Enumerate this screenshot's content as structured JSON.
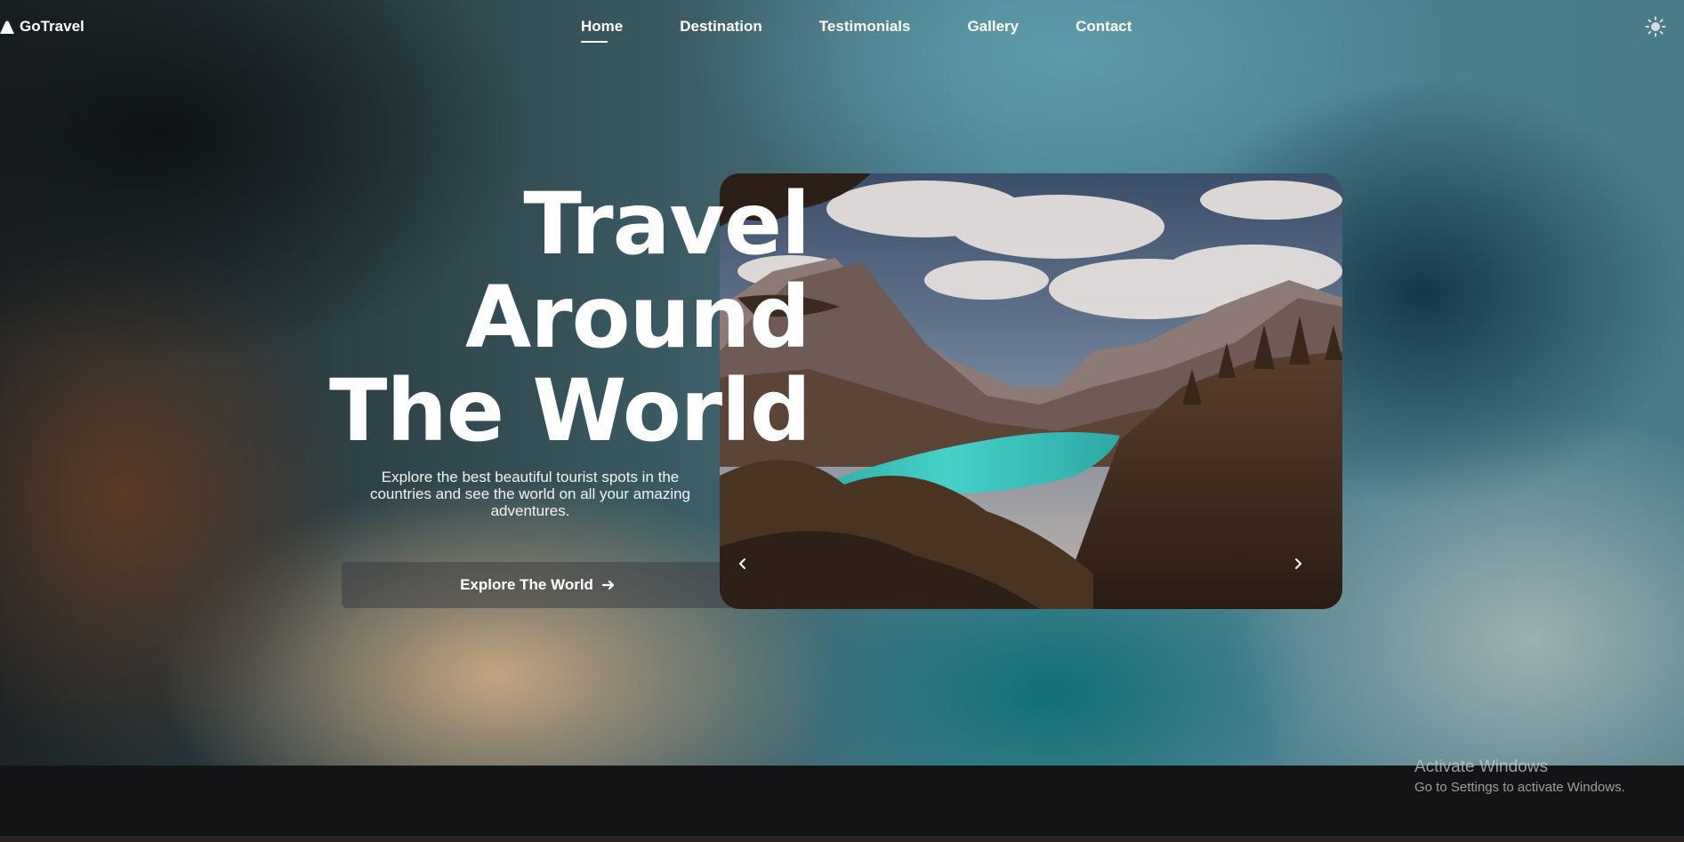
{
  "brand": {
    "name": "GoTravel",
    "logo_icon": "mountain-icon"
  },
  "nav": {
    "links": [
      {
        "label": "Home",
        "active": true
      },
      {
        "label": "Destination",
        "active": false
      },
      {
        "label": "Testimonials",
        "active": false
      },
      {
        "label": "Gallery",
        "active": false
      },
      {
        "label": "Contact",
        "active": false
      }
    ],
    "theme_icon": "sun-icon"
  },
  "hero": {
    "title_lines": [
      "Travel",
      "Around",
      "The World"
    ],
    "description": "Explore the best beautiful tourist spots in the countries and see the world on all your amazing adventures.",
    "cta_label": "Explore The World",
    "cta_icon": "arrow-right-icon"
  },
  "slider": {
    "image_subject": "mountain lake landscape",
    "prev_icon": "chevron-left-icon",
    "next_icon": "chevron-right-icon"
  },
  "watermark": {
    "title": "Activate Windows",
    "subtitle": "Go to Settings to activate Windows."
  },
  "colors": {
    "bottom_band": "#131416",
    "lake": "#3fc2c0",
    "card_shadow": "#1c2430"
  }
}
